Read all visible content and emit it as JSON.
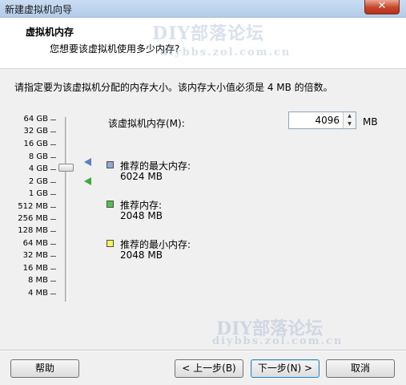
{
  "window": {
    "title": "新建虚拟机向导",
    "close_glyph": "✕"
  },
  "header": {
    "title": "虚拟机内存",
    "subtitle": "您想要该虚拟机使用多少内存?"
  },
  "watermark": {
    "top_line1": "DIY部落论坛",
    "top_line2": "diybbs.zol.com.cn",
    "bottom_line1": "DIY部落论坛",
    "bottom_line2": "diybbs.zol.com.cn"
  },
  "instruction": "请指定要为该虚拟机分配的内存大小。该内存大小值必须是 4 MB 的倍数。",
  "slider": {
    "ticks": [
      "64 GB",
      "32 GB",
      "16 GB",
      "8 GB",
      "4 GB",
      "2 GB",
      "1 GB",
      "512 MB",
      "256 MB",
      "128 MB",
      "64 MB",
      "32 MB",
      "16 MB",
      "8 MB",
      "4 MB"
    ],
    "selected": "4 GB"
  },
  "memory": {
    "label": "该虚拟机内存(M):",
    "value": "4096",
    "unit": "MB",
    "up_glyph": "▲",
    "down_glyph": "▼"
  },
  "legend": [
    {
      "label": "推荐的最大内存:",
      "value": "6024 MB",
      "color": "#8fa8d6"
    },
    {
      "label": "推荐内存:",
      "value": "2048 MB",
      "color": "#4cc24c"
    },
    {
      "label": "推荐的最小内存:",
      "value": "2048 MB",
      "color": "#f3f35a"
    }
  ],
  "buttons": {
    "help": "帮助",
    "back": "< 上一步(B)",
    "next": "下一步(N) >",
    "cancel": "取消"
  }
}
